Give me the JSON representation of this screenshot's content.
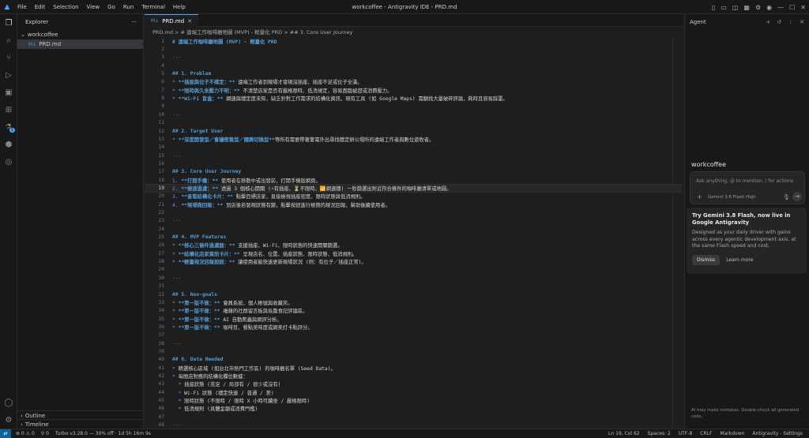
{
  "window": {
    "title": "workcoffee - Antigravity IDE - PRD.md",
    "menu": [
      "File",
      "Edit",
      "Selection",
      "View",
      "Go",
      "Run",
      "Terminal",
      "Help"
    ]
  },
  "sidebar": {
    "title": "Explorer",
    "folder": "workcoffee",
    "file": "PRD.md",
    "outline": "Outline",
    "timeline": "Timeline"
  },
  "editor": {
    "tab": "PRD.md",
    "breadcrumb": "PRD.md > # 遠端工作咖啡廳地圖 (MVP) - 輕量化 PRD > ## 3. Core User Journey",
    "lines": [
      {
        "n": "1",
        "t": "# 遠端工作咖啡廳地圖 (MVP) - 輕量化 PRD",
        "k": "h"
      },
      {
        "n": "2",
        "t": "",
        "k": "p"
      },
      {
        "n": "3",
        "t": "---",
        "k": "hr"
      },
      {
        "n": "4",
        "t": "",
        "k": "p"
      },
      {
        "n": "5",
        "t": "## 1. Problem",
        "k": "h"
      },
      {
        "n": "6",
        "b": "* ",
        "s": "**插座與位子不確定：**",
        "t": " 遠端工作者到現場才發現沒插座、插座不足或位子全滿。",
        "k": "li"
      },
      {
        "n": "7",
        "b": "* ",
        "s": "**限時與久坐壓力不明：**",
        "t": " 不清楚店家是否有嚴格限時、低消規定，容易面臨被趕或消費壓力。",
        "k": "li"
      },
      {
        "n": "8",
        "b": "* ",
        "s": "**Wi-Fi 盲盒：**",
        "t": " 網速與穩定度未知，缺乏針對工作需求的結構化資訊，現有工具 (如 Google Maps) 需翻找大量破碎評論，耗時且容易踩雷。",
        "k": "li"
      },
      {
        "n": "9",
        "t": "",
        "k": "p"
      },
      {
        "n": "10",
        "t": "---",
        "k": "hr"
      },
      {
        "n": "11",
        "t": "",
        "k": "p"
      },
      {
        "n": "12",
        "t": "## 2. Target User",
        "k": "h"
      },
      {
        "n": "13",
        "b": "* ",
        "s": "**深度開發型／會議密集型／隨興切換型**",
        "t": "等所有需要帶著筆電外出尋找穩定辦公場所的遠端工作者與數位遊牧者。",
        "k": "li"
      },
      {
        "n": "14",
        "t": "",
        "k": "p"
      },
      {
        "n": "15",
        "t": "---",
        "k": "hr"
      },
      {
        "n": "16",
        "t": "",
        "k": "p"
      },
      {
        "n": "17",
        "t": "## 3. Core User Journey",
        "k": "h"
      },
      {
        "n": "18",
        "b": "1. ",
        "s": "**打開手機：**",
        "t": " 使用者在移動中或出發前，打開手機版網頁。",
        "k": "li"
      },
      {
        "n": "19",
        "b": "2. ",
        "s": "**極速過濾：**",
        "t": " 透過 3 個核心開關 (⚡有插座、⏳不限時、📶網速穩) 一秒篩選出附近符合條件的咖啡廳清單或地圖。",
        "k": "li",
        "cur": true
      },
      {
        "n": "20",
        "b": "3. ",
        "s": "**查看結構化卡片：**",
        "t": " 點擊目標店家，直接檢視插座密度、限時狀態與低消規則。",
        "k": "li"
      },
      {
        "n": "21",
        "b": "4. ",
        "s": "**現場微回報：**",
        "t": " 到店後若發現狀態有變，點擊按鈕進行極簡的現況回報，幫助後續使用者。",
        "k": "li"
      },
      {
        "n": "22",
        "t": "",
        "k": "p"
      },
      {
        "n": "23",
        "t": "---",
        "k": "hr"
      },
      {
        "n": "24",
        "t": "",
        "k": "p"
      },
      {
        "n": "25",
        "t": "## 4. MVP Features",
        "k": "h"
      },
      {
        "n": "26",
        "b": "* ",
        "s": "**核心三條件過濾器：**",
        "t": " 支援插座、Wi-Fi、限時狀態的快速開關篩選。",
        "k": "li"
      },
      {
        "n": "27",
        "b": "* ",
        "s": "**結構化店家資訊卡片：**",
        "t": " 呈現店名、位置、插座狀態、限時狀態、低消規則。",
        "k": "li"
      },
      {
        "n": "28",
        "b": "* ",
        "s": "**輕量現況回報按鈕：**",
        "t": " 讓使用者能快速更新現場狀況 (例：有位子／插座正常)。",
        "k": "li"
      },
      {
        "n": "29",
        "t": "",
        "k": "p"
      },
      {
        "n": "30",
        "t": "---",
        "k": "hr"
      },
      {
        "n": "31",
        "t": "",
        "k": "p"
      },
      {
        "n": "32",
        "t": "## 5. Non-goals",
        "k": "h"
      },
      {
        "n": "33",
        "b": "* ",
        "s": "**第一版不做：**",
        "t": " 會員系統、個人帳號與收藏夾。",
        "k": "li"
      },
      {
        "n": "34",
        "b": "* ",
        "s": "**第一版不做：**",
        "t": " 複雜的社群留言板與長篇食記評論區。",
        "k": "li"
      },
      {
        "n": "35",
        "b": "* ",
        "s": "**第一版不做：**",
        "t": " AI 自動爬蟲與網評分析。",
        "k": "li"
      },
      {
        "n": "36",
        "b": "* ",
        "s": "**第一版不做：**",
        "t": " 咖啡豆、餐點美味度或網美打卡點評分。",
        "k": "li"
      },
      {
        "n": "37",
        "t": "",
        "k": "p"
      },
      {
        "n": "38",
        "t": "---",
        "k": "hr"
      },
      {
        "n": "39",
        "t": "",
        "k": "p"
      },
      {
        "n": "40",
        "t": "## 6. Data Needed",
        "k": "h"
      },
      {
        "n": "41",
        "b": "* ",
        "t": "精選核心區域 (如台北市熱門工作區) 的咖啡廳名單 (Seed Data)。",
        "k": "li"
      },
      {
        "n": "42",
        "b": "* ",
        "t": "每間店對應的結構化欄位數據：",
        "k": "li"
      },
      {
        "n": "43",
        "b": "  * ",
        "t": "插座狀態 (充足 / 局部有 / 很少或沒有)",
        "k": "li"
      },
      {
        "n": "44",
        "b": "  * ",
        "t": "Wi-Fi 狀態 (穩定快速 / 普通 / 差)",
        "k": "li"
      },
      {
        "n": "45",
        "b": "  * ",
        "t": "限時狀態 (不限時 / 限時 X 小時可續坐 / 嚴格限時)",
        "k": "li"
      },
      {
        "n": "46",
        "b": "  * ",
        "t": "低消規則 (具體金額或消費門檻)",
        "k": "li"
      },
      {
        "n": "47",
        "t": "",
        "k": "p"
      },
      {
        "n": "48",
        "t": "---",
        "k": "hr"
      }
    ]
  },
  "agent": {
    "title": "Agent",
    "workspace": "workcoffee",
    "input_placeholder": "Ask anything, @ to mention, / for actions",
    "model": "Gemini 3.6 Flash High",
    "card_title": "Try Gemini 3.8 Flash, now live in Google Antigravity",
    "card_body": "Designed as your daily driver with gains across every agentic development axis, at the same Flash speed and cost.",
    "dismiss": "Dismiss",
    "learn_more": "Learn more",
    "footer": "AI may make mistakes. Double-check all generated code."
  },
  "status": {
    "problems": "⊗ 0  ⚠ 0",
    "ports": "⚲ 0",
    "turbo": "Turbo v3.28.0 — 30% off · 1d 5h 16m 9s",
    "position": "Ln 19, Col 62",
    "spaces": "Spaces: 2",
    "encoding": "UTF-8",
    "eol": "CRLF",
    "language": "Markdown",
    "settings": "Antigravity - Settings"
  }
}
